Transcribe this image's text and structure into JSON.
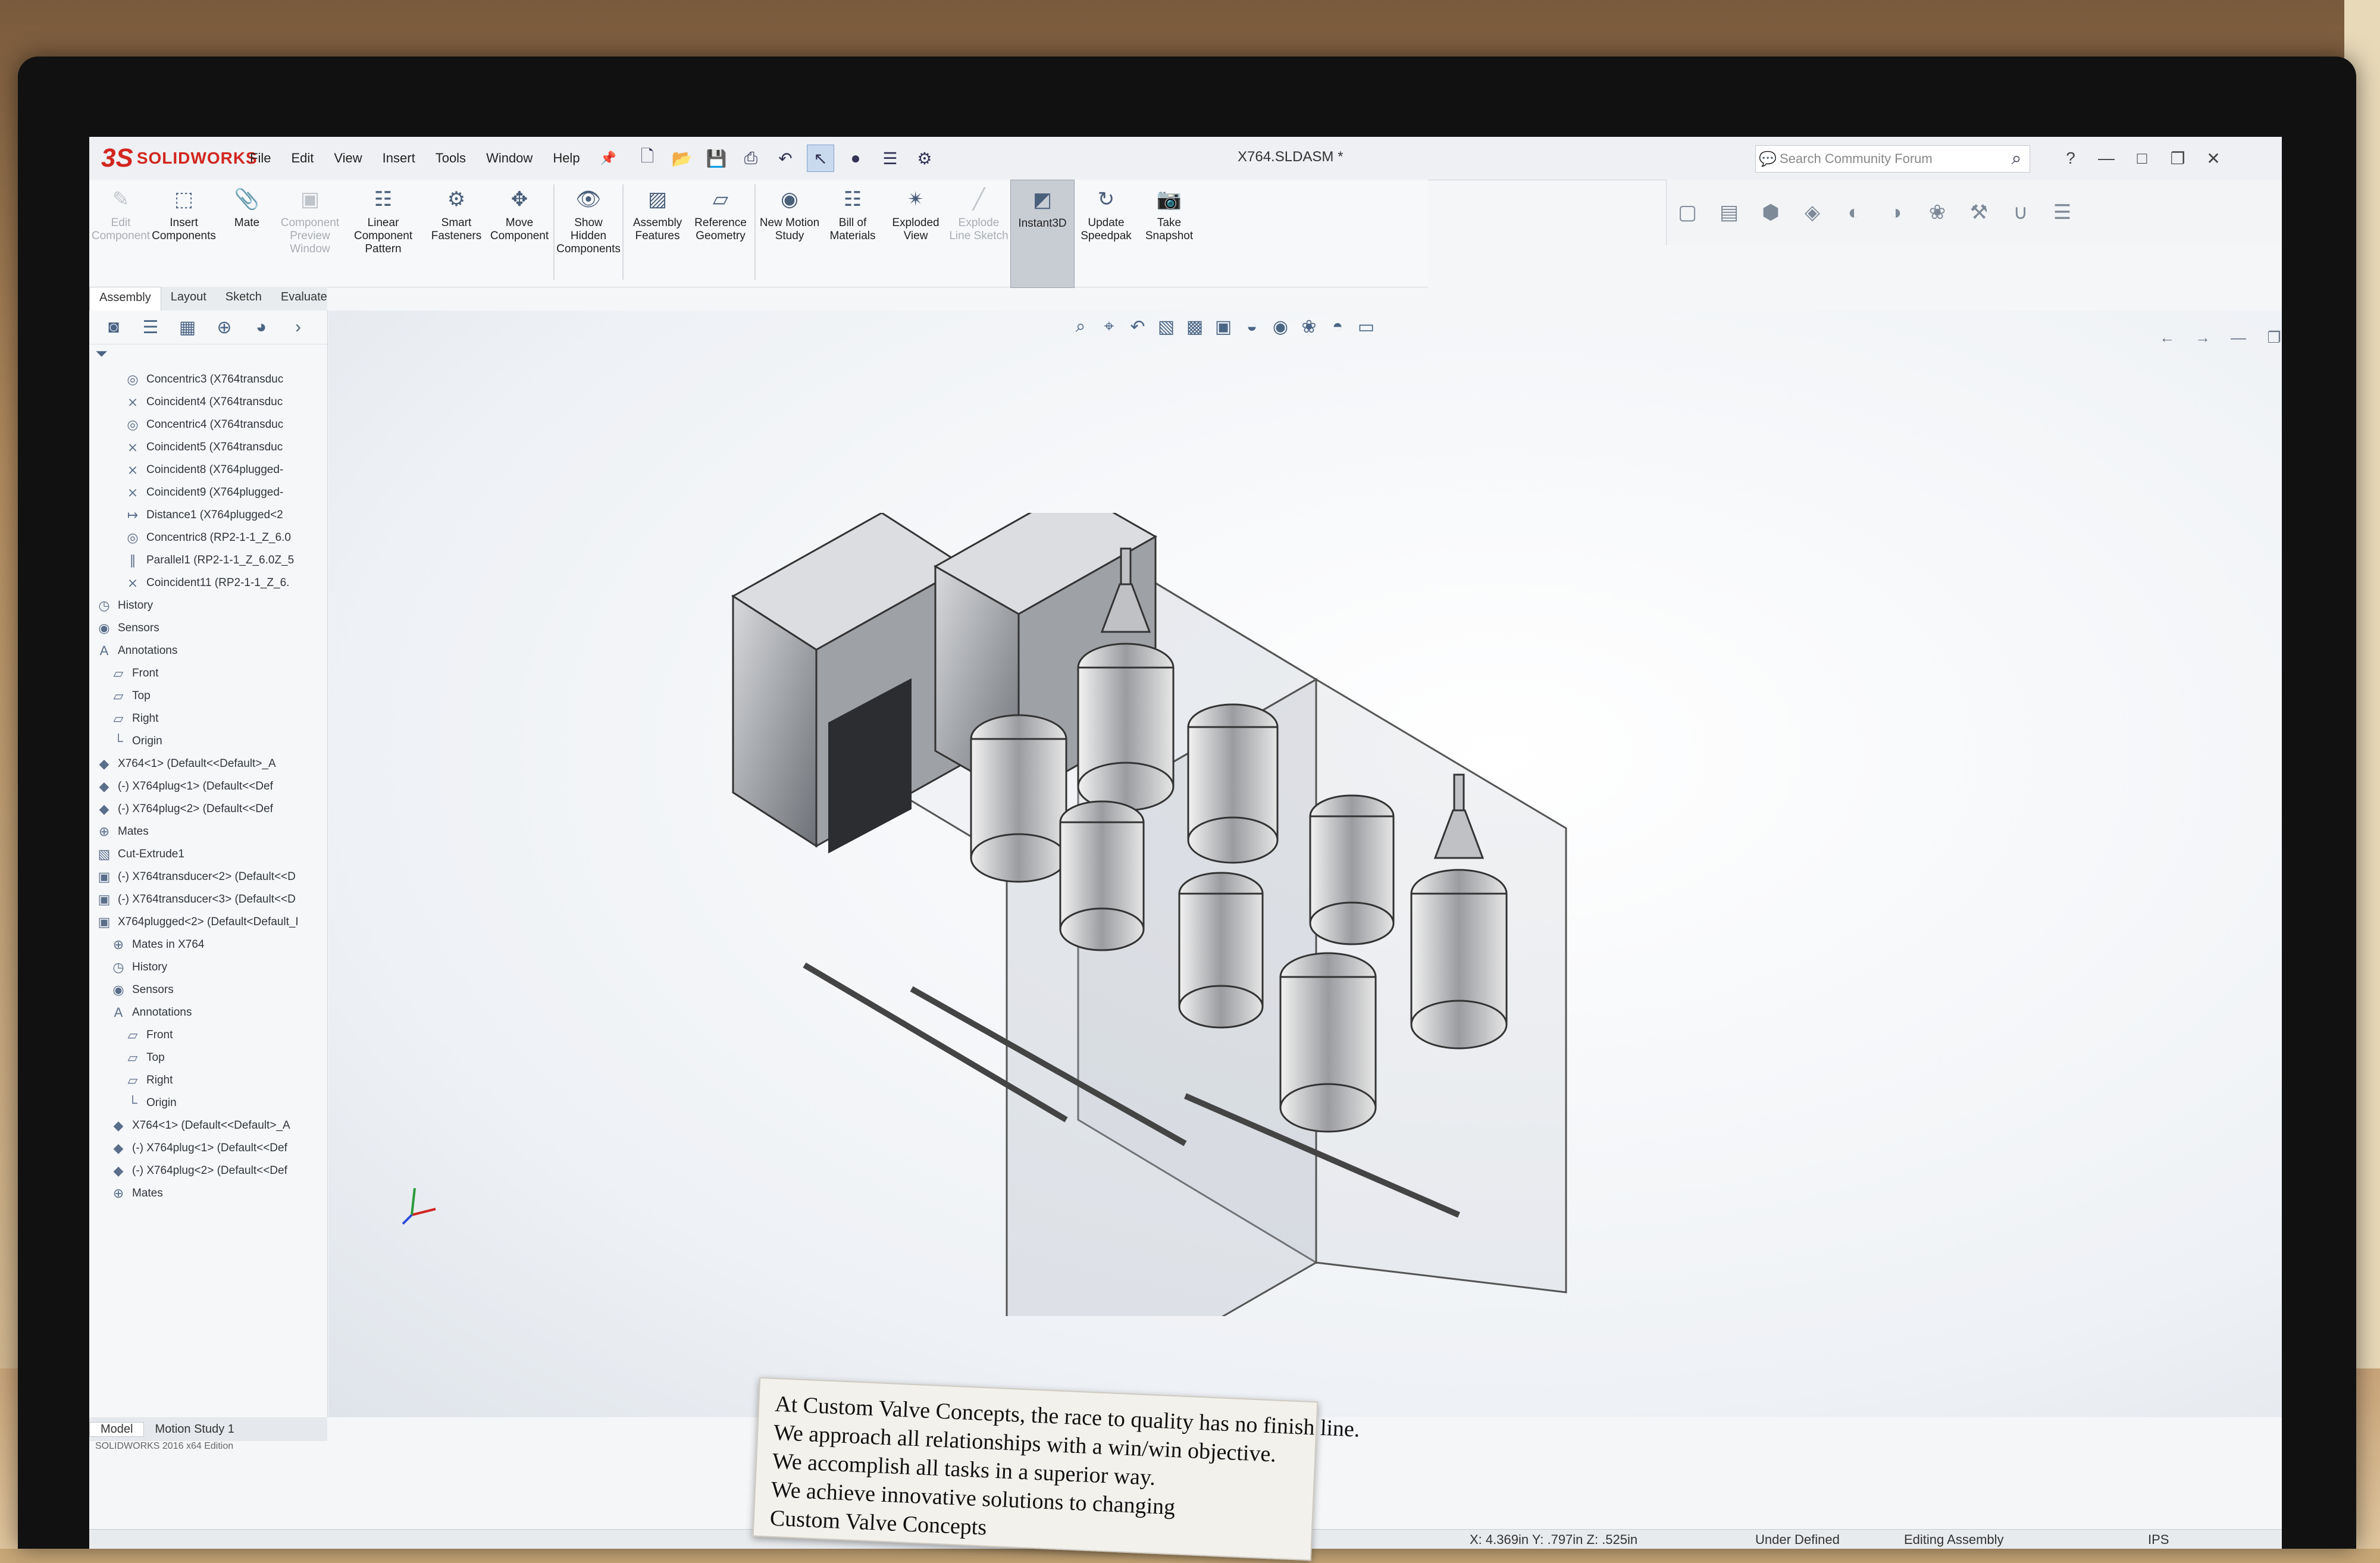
{
  "app": {
    "logo_mark": "3S",
    "logo_text": "SOLIDWORKS",
    "document_title": "X764.SLDASM *",
    "menu": [
      "File",
      "Edit",
      "View",
      "Insert",
      "Tools",
      "Window",
      "Help"
    ],
    "search_placeholder": "Search Community Forum",
    "help_glyph": "?"
  },
  "command_manager": {
    "groups": [
      {
        "label": "Edit Component",
        "icon": "edit-component-icon",
        "enabled": false
      },
      {
        "label": "Insert Components",
        "icon": "insert-components-icon",
        "enabled": true
      },
      {
        "label": "Mate",
        "icon": "mate-icon",
        "enabled": true
      },
      {
        "label": "Component Preview Window",
        "icon": "preview-window-icon",
        "enabled": false
      },
      {
        "label": "Linear Component Pattern",
        "icon": "linear-pattern-icon",
        "enabled": true
      },
      {
        "label": "Smart Fasteners",
        "icon": "smart-fasteners-icon",
        "enabled": true
      },
      {
        "label": "Move Component",
        "icon": "move-component-icon",
        "enabled": true
      },
      {
        "label": "Show Hidden Components",
        "icon": "show-hidden-icon",
        "enabled": true
      },
      {
        "label": "Assembly Features",
        "icon": "assembly-features-icon",
        "enabled": true
      },
      {
        "label": "Reference Geometry",
        "icon": "reference-geometry-icon",
        "enabled": true
      },
      {
        "label": "New Motion Study",
        "icon": "motion-study-icon",
        "enabled": true
      },
      {
        "label": "Bill of Materials",
        "icon": "bom-icon",
        "enabled": true
      },
      {
        "label": "Exploded View",
        "icon": "exploded-view-icon",
        "enabled": true
      },
      {
        "label": "Explode Line Sketch",
        "icon": "explode-line-icon",
        "enabled": false
      },
      {
        "label": "Instant3D",
        "icon": "instant3d-icon",
        "enabled": true,
        "selected": true
      },
      {
        "label": "Update Speedpak",
        "icon": "speedpak-icon",
        "enabled": true
      },
      {
        "label": "Take Snapshot",
        "icon": "camera-icon",
        "enabled": true
      }
    ]
  },
  "tabs": [
    "Assembly",
    "Layout",
    "Sketch",
    "Evaluate"
  ],
  "active_tab": "Assembly",
  "feature_tree": [
    {
      "label": "Concentric3 (X764transduc",
      "icon": "concentric-icon",
      "indent": 2
    },
    {
      "label": "Coincident4 (X764transduc",
      "icon": "coincident-icon",
      "indent": 2
    },
    {
      "label": "Concentric4 (X764transduc",
      "icon": "concentric-icon",
      "indent": 2
    },
    {
      "label": "Coincident5 (X764transduc",
      "icon": "coincident-icon",
      "indent": 2
    },
    {
      "label": "Coincident8 (X764plugged-",
      "icon": "coincident-icon",
      "indent": 2
    },
    {
      "label": "Coincident9 (X764plugged-",
      "icon": "coincident-icon",
      "indent": 2
    },
    {
      "label": "Distance1 (X764plugged<2",
      "icon": "distance-icon",
      "indent": 2
    },
    {
      "label": "Concentric8 (RP2-1-1_Z_6.0",
      "icon": "concentric-icon",
      "indent": 2
    },
    {
      "label": "Parallel1 (RP2-1-1_Z_6.0Z_5",
      "icon": "parallel-icon",
      "indent": 2
    },
    {
      "label": "Coincident11 (RP2-1-1_Z_6.",
      "icon": "coincident-icon",
      "indent": 2
    },
    {
      "label": "History",
      "icon": "history-icon",
      "indent": 0
    },
    {
      "label": "Sensors",
      "icon": "sensor-icon",
      "indent": 0
    },
    {
      "label": "Annotations",
      "icon": "annotation-icon",
      "indent": 0
    },
    {
      "label": "Front",
      "icon": "plane-icon",
      "indent": 1
    },
    {
      "label": "Top",
      "icon": "plane-icon",
      "indent": 1
    },
    {
      "label": "Right",
      "icon": "plane-icon",
      "indent": 1
    },
    {
      "label": "Origin",
      "icon": "origin-icon",
      "indent": 1
    },
    {
      "label": "X764<1> (Default<<Default>_A",
      "icon": "part-icon",
      "indent": 0
    },
    {
      "label": "(-) X764plug<1> (Default<<Def",
      "icon": "part-icon",
      "indent": 0
    },
    {
      "label": "(-) X764plug<2> (Default<<Def",
      "icon": "part-icon",
      "indent": 0
    },
    {
      "label": "Mates",
      "icon": "mates-icon",
      "indent": 0
    },
    {
      "label": "Cut-Extrude1",
      "icon": "cut-extrude-icon",
      "indent": 0
    },
    {
      "label": "(-) X764transducer<2> (Default<<D",
      "icon": "assembly-icon",
      "indent": 0
    },
    {
      "label": "(-) X764transducer<3> (Default<<D",
      "icon": "assembly-icon",
      "indent": 0
    },
    {
      "label": "X764plugged<2> (Default<Default_I",
      "icon": "assembly-icon",
      "indent": 0
    },
    {
      "label": "Mates in X764",
      "icon": "mates-icon",
      "indent": 1
    },
    {
      "label": "History",
      "icon": "history-icon",
      "indent": 1
    },
    {
      "label": "Sensors",
      "icon": "sensor-icon",
      "indent": 1
    },
    {
      "label": "Annotations",
      "icon": "annotation-icon",
      "indent": 1
    },
    {
      "label": "Front",
      "icon": "plane-icon",
      "indent": 2
    },
    {
      "label": "Top",
      "icon": "plane-icon",
      "indent": 2
    },
    {
      "label": "Right",
      "icon": "plane-icon",
      "indent": 2
    },
    {
      "label": "Origin",
      "icon": "origin-icon",
      "indent": 2
    },
    {
      "label": "X764<1> (Default<<Default>_A",
      "icon": "part-icon",
      "indent": 1
    },
    {
      "label": "(-) X764plug<1> (Default<<Def",
      "icon": "part-icon",
      "indent": 1
    },
    {
      "label": "(-) X764plug<2> (Default<<Def",
      "icon": "part-icon",
      "indent": 1
    },
    {
      "label": "Mates",
      "icon": "mates-icon",
      "indent": 1
    }
  ],
  "bottom_tabs": [
    "Model",
    "Motion Study 1"
  ],
  "active_bottom_tab": "Model",
  "version": "SOLIDWORKS 2016 x64 Edition",
  "status_bar": {
    "coordinates": "X: 4.369in Y: .797in Z: .525in",
    "state": "Under Defined",
    "mode": "Editing Assembly",
    "units": "IPS"
  },
  "notice_lines": [
    "At Custom Valve Concepts, the race to quality has no finish line.",
    "We approach all relationships with a win/win objective.",
    "We accomplish all tasks in a superior way.",
    "We achieve innovative solutions to changing",
    "Custom Valve Concepts"
  ],
  "colors": {
    "brand_red": "#d2261f",
    "selected_command_bg": "#c8cdd4",
    "icon_blue": "#4b6585"
  }
}
